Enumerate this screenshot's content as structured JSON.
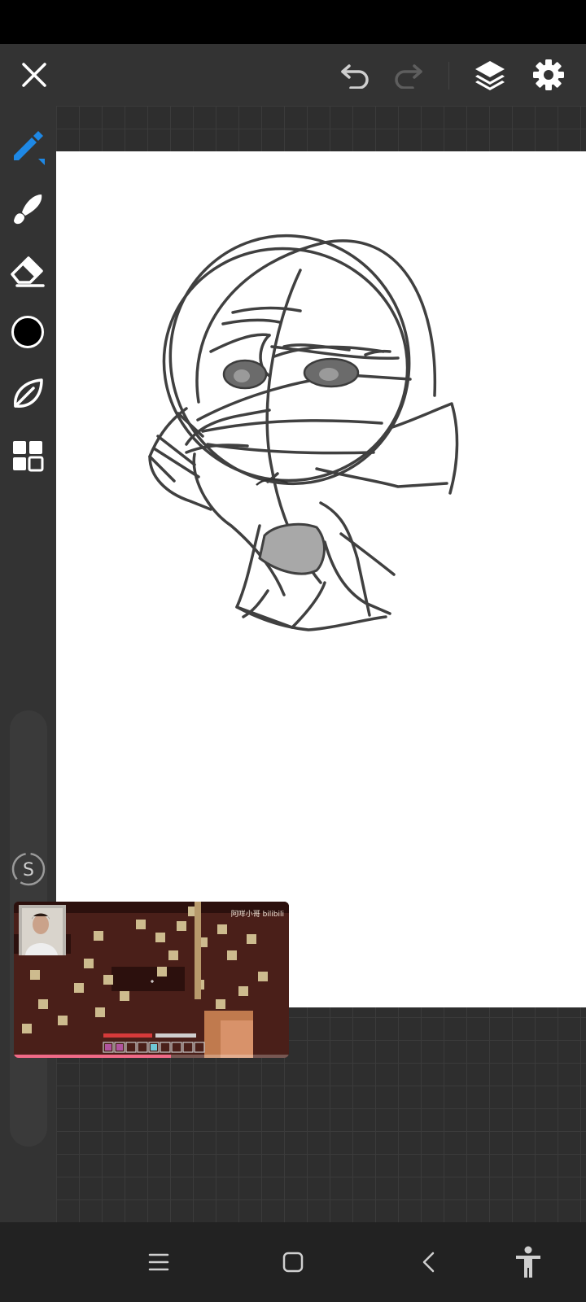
{
  "app": {
    "toolbar": {
      "close": "close-icon",
      "undo": "undo-icon",
      "redo": "redo-icon",
      "layers": "layers-icon",
      "settings": "gear-icon"
    },
    "tools": [
      "pen-icon",
      "brush-icon",
      "eraser-icon",
      "color-swatch",
      "leaf-icon",
      "grid-icon"
    ],
    "current_color": "#000000",
    "accent_color": "#1e88e5"
  },
  "pip": {
    "watermark": "阿咩小哥 bilibili",
    "progress": 0.57
  },
  "nav": [
    "menu-icon",
    "home-icon",
    "back-icon",
    "accessibility-icon"
  ]
}
